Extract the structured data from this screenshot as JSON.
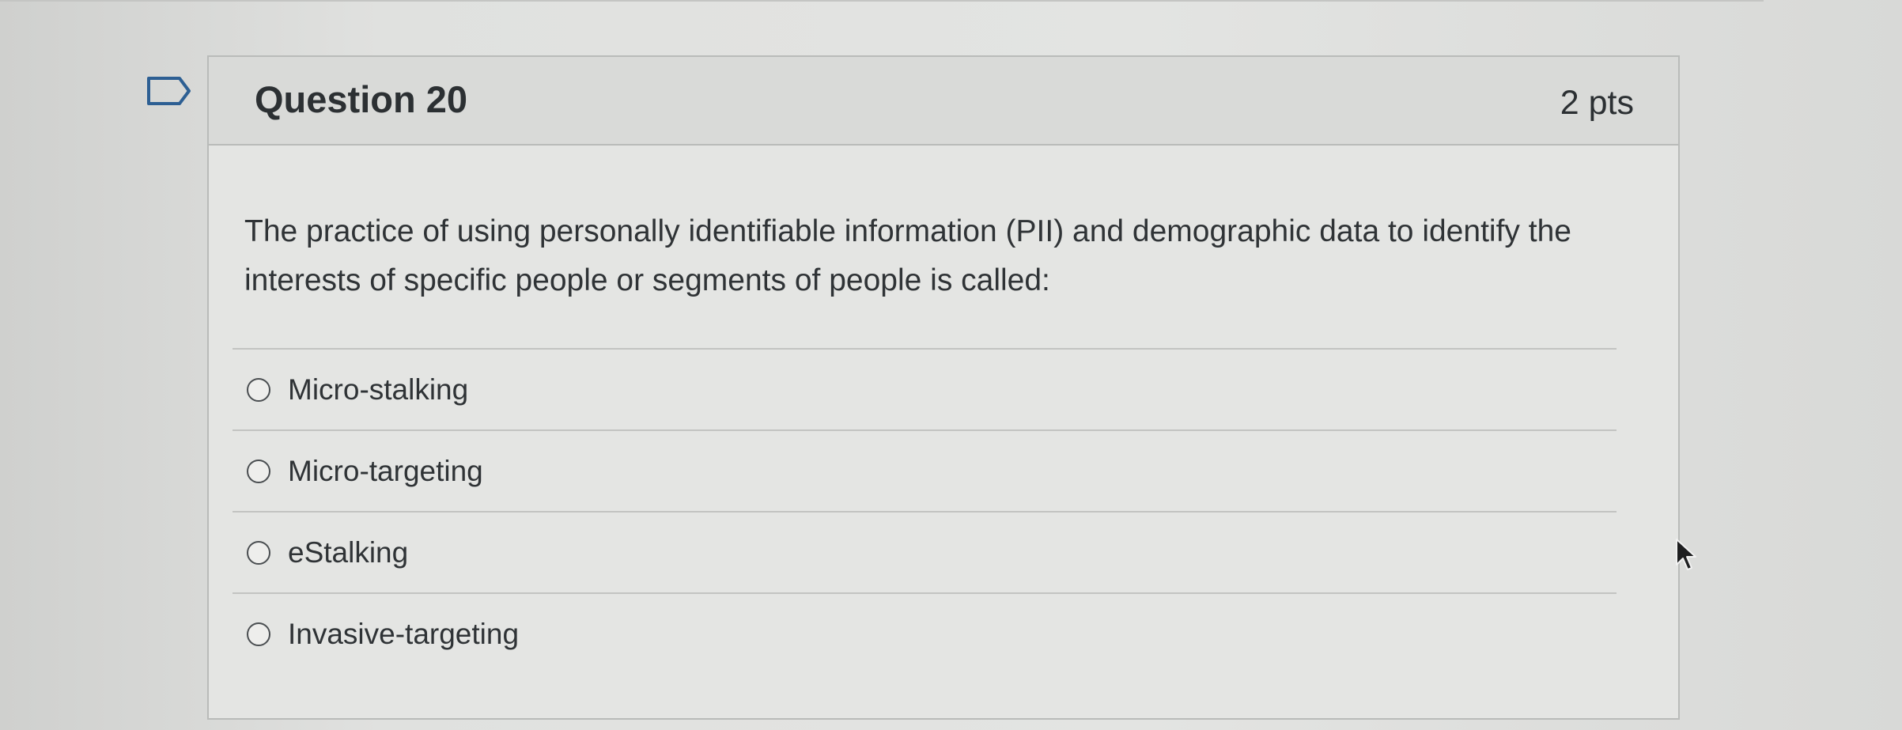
{
  "question": {
    "title": "Question 20",
    "points": "2 pts",
    "text": "The practice of using personally identifiable information (PII) and demographic data to identify the interests of specific people or segments of people is called:",
    "options": [
      {
        "label": "Micro-stalking",
        "selected": false
      },
      {
        "label": "Micro-targeting",
        "selected": false
      },
      {
        "label": "eStalking",
        "selected": false
      },
      {
        "label": "Invasive-targeting",
        "selected": false
      }
    ]
  },
  "icons": {
    "flag": "flag-icon",
    "cursor": "mouse-pointer-icon"
  }
}
